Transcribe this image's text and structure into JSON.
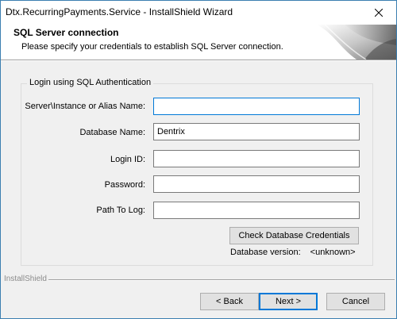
{
  "window": {
    "title": "Dtx.RecurringPayments.Service - InstallShield Wizard"
  },
  "header": {
    "title": "SQL Server connection",
    "subtitle": "Please specify your credentials to establish SQL Server connection."
  },
  "group": {
    "legend": "Login using SQL Authentication"
  },
  "fields": {
    "server": {
      "label": "Server\\Instance or Alias Name:",
      "value": ""
    },
    "database": {
      "label": "Database Name:",
      "value": "Dentrix"
    },
    "login": {
      "label": "Login ID:",
      "value": ""
    },
    "password": {
      "label": "Password:",
      "value": ""
    },
    "log_path": {
      "label": "Path To Log:",
      "value": ""
    }
  },
  "check_button": "Check Database Credentials",
  "db_version": {
    "label": "Database version:",
    "value": "<unknown>"
  },
  "brand": "InstallShield",
  "nav": {
    "back": "< Back",
    "next": "Next >",
    "cancel": "Cancel"
  },
  "icons": {
    "close": "close-icon",
    "header_art": "installshield-banner-art"
  }
}
